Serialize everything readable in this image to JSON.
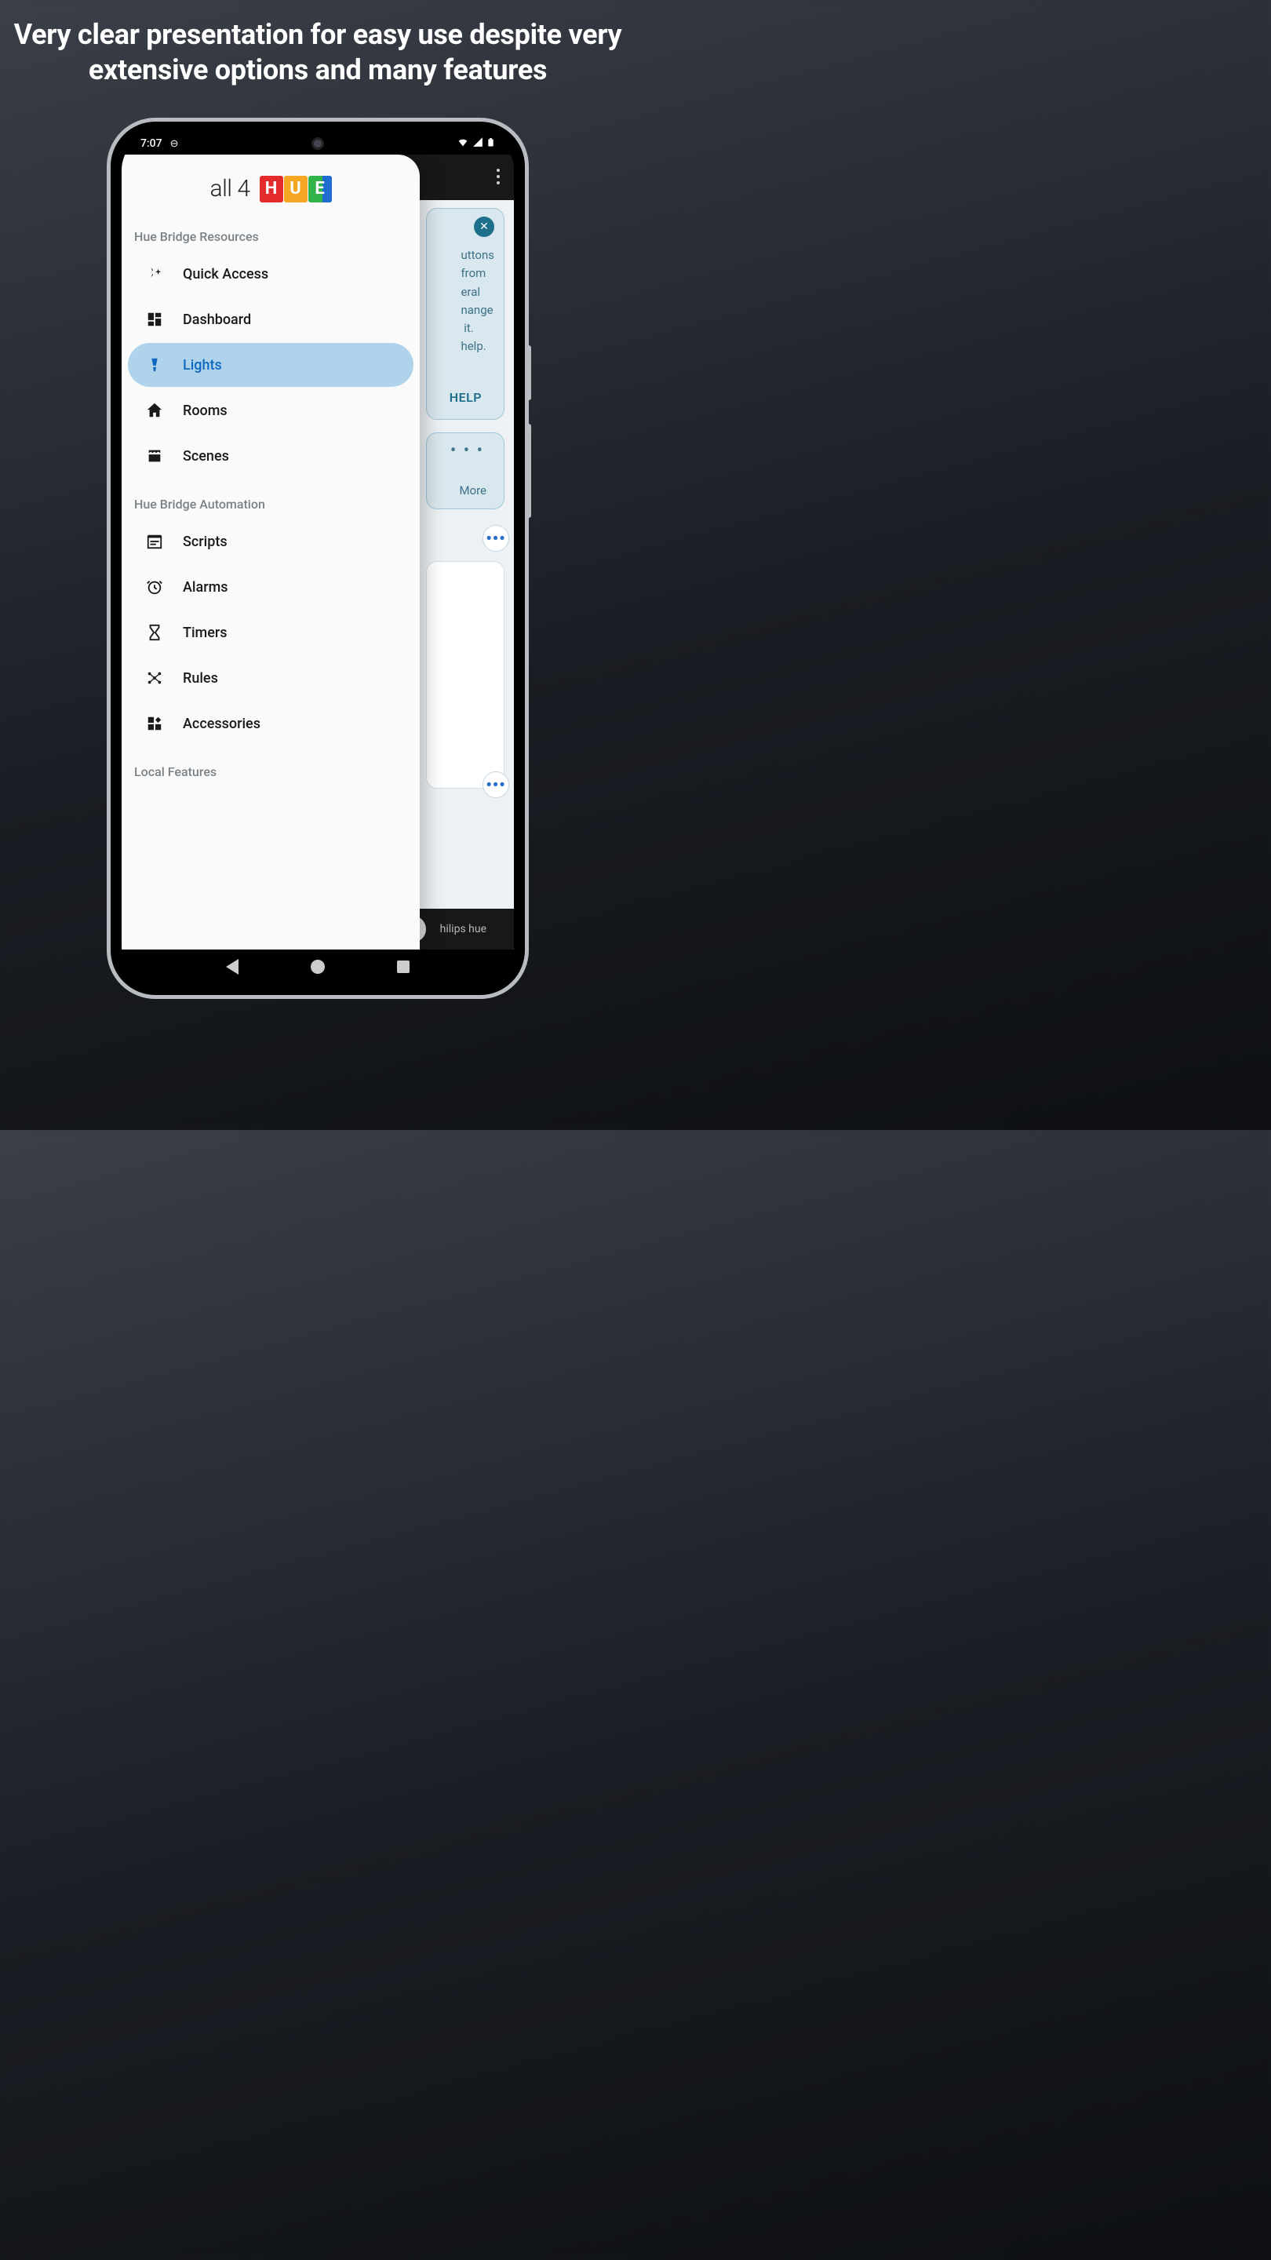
{
  "headline": "Very clear presentation for easy use despite very extensive options and many features",
  "status": {
    "time": "7:07"
  },
  "logo": {
    "prefix": "all 4",
    "h": "H",
    "u": "U",
    "e": "E"
  },
  "sections": {
    "resources_label": "Hue Bridge Resources",
    "automation_label": "Hue Bridge Automation",
    "local_label": "Local Features"
  },
  "menu": {
    "quick_access": "Quick Access",
    "dashboard": "Dashboard",
    "lights": "Lights",
    "rooms": "Rooms",
    "scenes": "Scenes",
    "scripts": "Scripts",
    "alarms": "Alarms",
    "timers": "Timers",
    "rules": "Rules",
    "accessories": "Accessories"
  },
  "bg": {
    "card1_lines": "uttons\nfrom\neral\nnange\n it.\nhelp.",
    "help": "HELP",
    "dots": "• • •",
    "more": "More",
    "footer_label": "hilips hue"
  }
}
